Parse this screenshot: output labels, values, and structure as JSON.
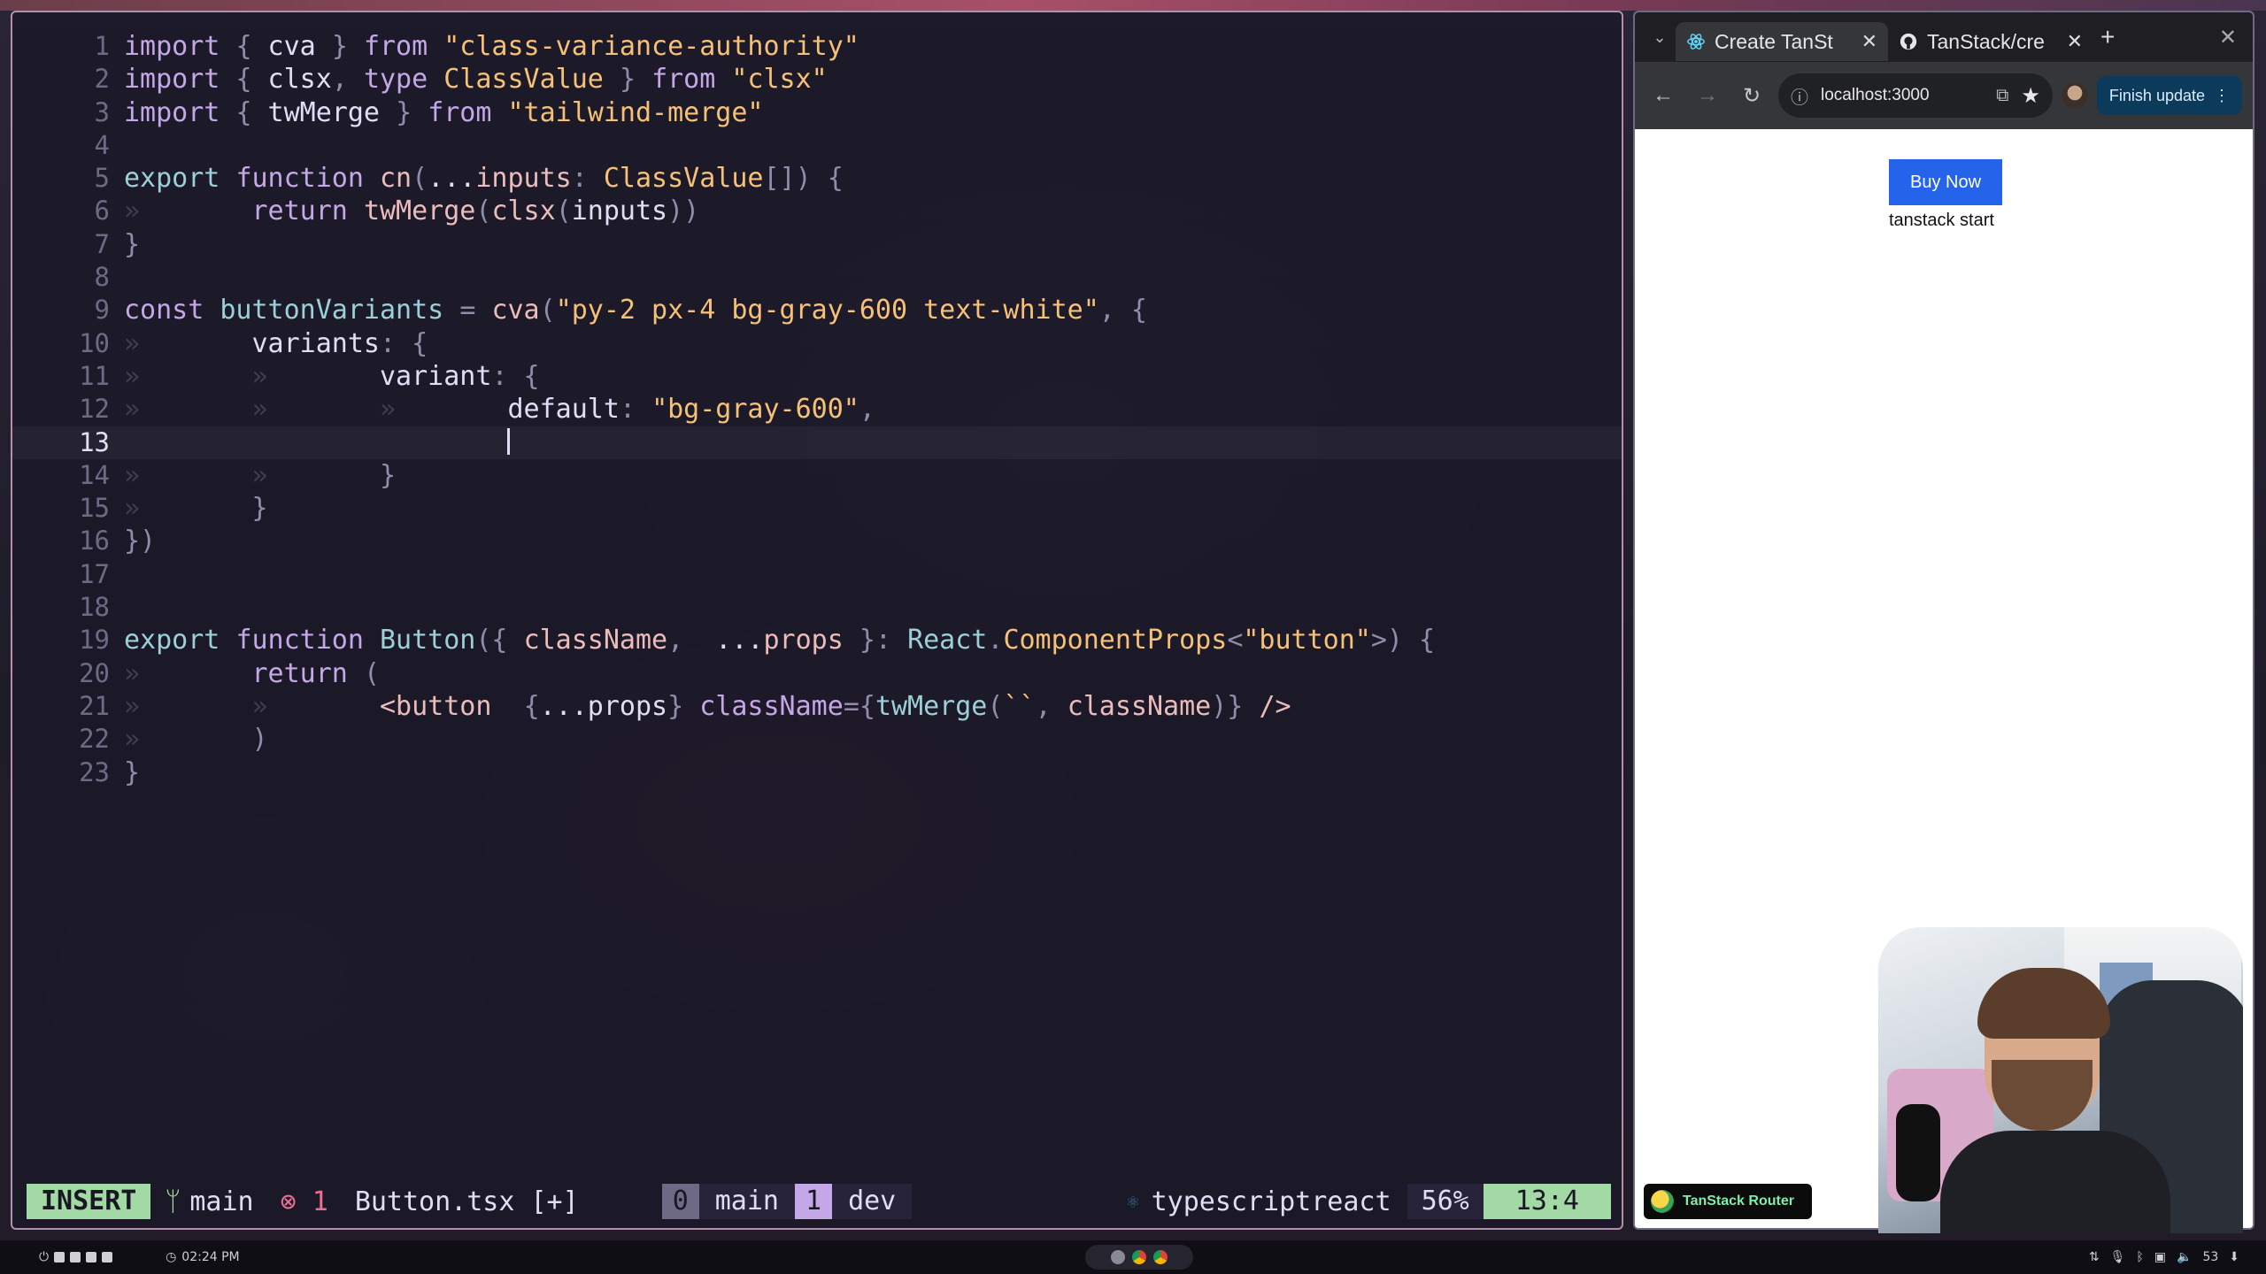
{
  "editor": {
    "lines": [
      {
        "n": "1",
        "html": "<span class='kw2'>import</span> <span class='pun'>{</span> cva <span class='pun'>}</span> <span class='kw2'>from</span> <span class='str'>\"class-variance-authority\"</span>"
      },
      {
        "n": "2",
        "html": "<span class='kw2'>import</span> <span class='pun'>{</span> clsx<span class='pun'>,</span> <span class='kw2'>type</span> <span class='ty'>ClassValue</span> <span class='pun'>}</span> <span class='kw2'>from</span> <span class='str'>\"clsx\"</span>"
      },
      {
        "n": "3",
        "html": "<span class='kw2'>import</span> <span class='pun'>{</span> twMerge <span class='pun'>}</span> <span class='kw2'>from</span> <span class='str'>\"tailwind-merge\"</span>"
      },
      {
        "n": "4",
        "html": ""
      },
      {
        "n": "5",
        "html": "<span class='kw'>export</span> <span class='kw2'>function</span> <span class='fn'>cn</span><span class='pun'>(</span>...<span class='fn'>inputs</span><span class='pun'>:</span> <span class='ty'>ClassValue</span><span class='pun'>[]) {</span>"
      },
      {
        "n": "6",
        "html": "<span class='guide'>»</span>       <span class='kw2'>return</span> <span class='fn'>twMerge</span><span class='pun'>(</span><span class='fn'>clsx</span><span class='pun'>(</span>inputs<span class='pun'>))</span>"
      },
      {
        "n": "7",
        "html": "<span class='pun'>}</span>"
      },
      {
        "n": "8",
        "html": ""
      },
      {
        "n": "9",
        "html": "<span class='kw2'>const</span> <span class='kw'>buttonVariants</span> <span class='pun'>=</span> <span class='fn'>cva</span><span class='pun'>(</span><span class='str'>\"py-2 px-4 bg-gray-600 text-white\"</span><span class='pun'>, {</span>"
      },
      {
        "n": "10",
        "html": "<span class='guide'>»</span>       variants<span class='pun'>: {</span>"
      },
      {
        "n": "11",
        "html": "<span class='guide'>»</span>       <span class='guide'>»</span>       variant<span class='pun'>: {</span>"
      },
      {
        "n": "12",
        "html": "<span class='guide'>»</span>       <span class='guide'>»</span>       <span class='guide'>»</span>       default<span class='pun'>:</span> <span class='str'>\"bg-gray-600\"</span><span class='pun'>,</span>"
      },
      {
        "n": "13",
        "html": "                        <span class='cursor'></span>",
        "current": true
      },
      {
        "n": "14",
        "html": "<span class='guide'>»</span>       <span class='guide'>»</span>       <span class='pun'>}</span>"
      },
      {
        "n": "15",
        "html": "<span class='guide'>»</span>       <span class='pun'>}</span>"
      },
      {
        "n": "16",
        "html": "<span class='pun'>})</span>"
      },
      {
        "n": "17",
        "html": ""
      },
      {
        "n": "18",
        "html": ""
      },
      {
        "n": "19",
        "html": "<span class='kw'>export</span> <span class='kw2'>function</span> <span class='kw'>Button</span><span class='pun'>({</span> <span class='fn'>className</span><span class='pun'>,</span>  ...<span class='fn'>props</span> <span class='pun'>}:</span> <span class='kw'>React</span><span class='pun'>.</span><span class='ty'>ComponentProps</span><span class='pun'>&lt;</span><span class='str'>\"button\"</span><span class='pun'>&gt;) {</span>"
      },
      {
        "n": "20",
        "html": "<span class='guide'>»</span>       <span class='kw2'>return</span> <span class='pun'>(</span>"
      },
      {
        "n": "21",
        "html": "<span class='guide'>»</span>       <span class='guide'>»</span>       <span class='tag'>&lt;button</span>  <span class='pun'>{</span>...props<span class='pun'>}</span> <span class='attr'>className</span><span class='pun'>={</span><span class='kw'>twMerge</span><span class='pun'>(</span><span class='str'>``</span><span class='pun'>,</span> <span class='fn'>className</span><span class='pun'>)}</span> <span class='tag'>/&gt;</span>"
      },
      {
        "n": "22",
        "html": "<span class='guide'>»</span>       <span class='pun'>)</span>"
      },
      {
        "n": "23",
        "html": "<span class='pun'>}</span>"
      }
    ]
  },
  "statusline": {
    "mode": "INSERT",
    "branch": "main",
    "errors": "1",
    "filename": "Button.tsx [+]",
    "tab0_num": "0",
    "tab0_name": "main",
    "tab1_num": "1",
    "tab1_name": "dev",
    "filetype": "typescriptreact",
    "percent": "56%",
    "position": "13:4"
  },
  "browser": {
    "tabs": [
      {
        "title": "Create TanSt",
        "active": true
      },
      {
        "title": "TanStack/cre",
        "active": false
      }
    ],
    "url": "localhost:3000",
    "finish_update": "Finish update",
    "page": {
      "button_label": "Buy Now",
      "text": "tanstack start"
    },
    "router_badge": "TanStack Router"
  },
  "taskbar": {
    "time": "02:24 PM",
    "volume": "53"
  },
  "colors": {
    "editor_border": "#b48ead",
    "mode_bg": "#a3d9a5",
    "button_bg": "#2563eb"
  }
}
